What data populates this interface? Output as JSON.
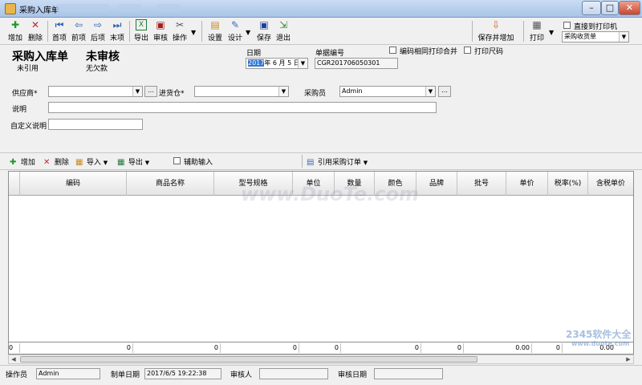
{
  "window": {
    "title": "采购入库单",
    "controls": {
      "minimize": "–",
      "maximize": "□",
      "close": "✕"
    }
  },
  "toolbar": {
    "add": "增加",
    "delete": "删除",
    "first": "首项",
    "prev": "前项",
    "next": "后项",
    "last": "末项",
    "export": "导出",
    "audit": "审核",
    "operation": "操作",
    "settings": "设置",
    "design": "设计",
    "save": "保存",
    "exit": "退出",
    "save_and_add": "保存并增加",
    "print": "打印",
    "direct_print_label": "直接到打印机",
    "print_template": "采购收货单"
  },
  "header": {
    "doc_title": "采购入库单",
    "print_status": "未引用",
    "audit_title": "未审核",
    "debt_status": "无欠款",
    "date_label": "日期",
    "date_year": "2017",
    "date_rest": "年 6 月 5 日",
    "doc_no_label": "单据编号",
    "doc_no_value": "CGR201706050301",
    "merge_print_label": "编码相同打印合并",
    "print_size_label": "打印尺码",
    "supplier_label": "供应商*",
    "supplier_value": "",
    "warehouse_label": "进货仓*",
    "warehouse_value": "",
    "buyer_label": "采购员",
    "buyer_value": "Admin",
    "note_label": "说明",
    "note_value": "",
    "custom_note_label": "自定义说明",
    "custom_note_value": ""
  },
  "detail_toolbar": {
    "add": "增加",
    "delete": "删除",
    "import": "导入",
    "export": "导出",
    "assist_input": "辅助输入",
    "ref_order": "引用采购订单"
  },
  "grid": {
    "columns": [
      "编码",
      "商品名称",
      "型号规格",
      "单位",
      "数量",
      "颜色",
      "品牌",
      "批号",
      "单价",
      "税率(%)",
      "含税单价"
    ],
    "footer_values": [
      "0",
      "0",
      "0",
      "0",
      "0",
      "0",
      "0",
      "0.00",
      "0",
      "0.00"
    ]
  },
  "statusbar": {
    "operator_label": "操作员",
    "operator_value": "Admin",
    "created_label": "制单日期",
    "created_value": "2017/6/5 19:22:38",
    "auditor_label": "审核人",
    "auditor_value": "",
    "audit_date_label": "审核日期",
    "audit_date_value": ""
  },
  "watermark": {
    "text": "www.DuoTe.com",
    "logo_text": "2345软件大全",
    "logo_url": "www.duote.com"
  }
}
